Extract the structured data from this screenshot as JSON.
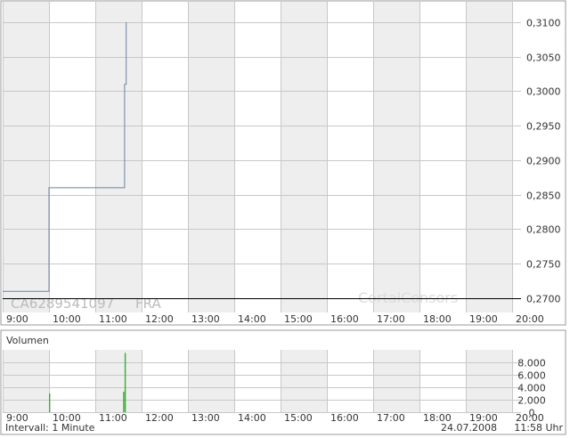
{
  "chart_data": [
    {
      "type": "line",
      "title": "",
      "instrument": "CA6289541097",
      "exchange": "FRA",
      "watermark": "CortalConsors",
      "x_ticks": [
        "9:00",
        "10:00",
        "11:00",
        "12:00",
        "13:00",
        "14:00",
        "15:00",
        "16:00",
        "17:00",
        "18:00",
        "19:00",
        "20:00"
      ],
      "y_ticks": [
        "0,3100",
        "0,3050",
        "0,3000",
        "0,2950",
        "0,2900",
        "0,2850",
        "0,2800",
        "0,2750",
        "0,2700"
      ],
      "ylim": [
        0.27,
        0.311
      ],
      "xlim": [
        "9:00",
        "20:00"
      ],
      "reference_line": 0.27,
      "series": [
        {
          "color": "#6a82a8",
          "points": [
            {
              "x": "9:00",
              "y": 0.271
            },
            {
              "x": "10:00",
              "y": 0.271
            },
            {
              "x": "10:00",
              "y": 0.286
            },
            {
              "x": "11:38",
              "y": 0.286
            },
            {
              "x": "11:38",
              "y": 0.301
            },
            {
              "x": "11:40",
              "y": 0.301
            },
            {
              "x": "11:40",
              "y": 0.31
            }
          ]
        }
      ],
      "grid": true,
      "shaded_columns": true
    },
    {
      "type": "bar",
      "title": "Volumen",
      "x_ticks": [
        "9:00",
        "10:00",
        "11:00",
        "12:00",
        "13:00",
        "14:00",
        "15:00",
        "16:00",
        "17:00",
        "18:00",
        "19:00",
        "20:00"
      ],
      "y_ticks": [
        "8.000",
        "6.000",
        "4.000",
        "2.000",
        "0"
      ],
      "ylim": [
        0,
        10000
      ],
      "bar_color": "#2fb22f",
      "bars": [
        {
          "x": "10:00",
          "value": 3000
        },
        {
          "x": "11:36",
          "value": 3300
        },
        {
          "x": "11:38",
          "value": 9500
        }
      ]
    }
  ],
  "footer": {
    "interval": "Intervall: 1 Minute",
    "date": "24.07.2008",
    "time": "11:58 Uhr"
  },
  "colors": {
    "shade": "#eeeeee",
    "grid": "#c8c8c8",
    "border": "#999999",
    "text": "#333333"
  }
}
